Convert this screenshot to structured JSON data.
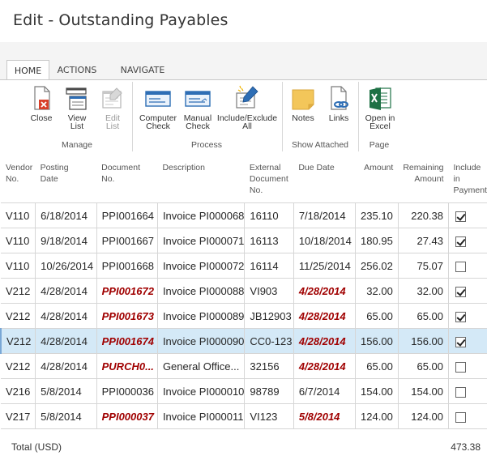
{
  "page": {
    "title": "Edit - Outstanding Payables"
  },
  "tabs": [
    {
      "label": "HOME"
    },
    {
      "label": "ACTIONS"
    },
    {
      "label": "NAVIGATE"
    }
  ],
  "ribbon": {
    "buttons": [
      {
        "label": "Close",
        "icon": "close-icon"
      },
      {
        "label": "View\nList",
        "icon": "view-list-icon"
      },
      {
        "label": "Edit\nList",
        "icon": "edit-list-icon"
      },
      {
        "label": "Computer\nCheck",
        "icon": "computer-check-icon"
      },
      {
        "label": "Manual\nCheck",
        "icon": "manual-check-icon"
      },
      {
        "label": "Include/Exclude\nAll",
        "icon": "include-exclude-icon"
      },
      {
        "label": "Notes",
        "icon": "notes-icon"
      },
      {
        "label": "Links",
        "icon": "links-icon"
      },
      {
        "label": "Open in\nExcel",
        "icon": "excel-icon"
      }
    ],
    "groups": [
      {
        "label": "Manage"
      },
      {
        "label": "Process"
      },
      {
        "label": "Show Attached"
      },
      {
        "label": "Page"
      }
    ]
  },
  "table": {
    "headers": [
      "Vendor\nNo.",
      "Posting\nDate",
      "Document\nNo.",
      "Description",
      "External\nDocument\nNo.",
      "Due Date",
      "Amount",
      "Remaining\nAmount",
      "Include\nin\nPayment"
    ],
    "rows": [
      {
        "vendor": "V110",
        "posting": "6/18/2014",
        "doc": "PPI001664",
        "desc": "Invoice PI000068",
        "ext": "16110",
        "due": "7/18/2014",
        "amount": "235.10",
        "remaining": "220.38",
        "include": true,
        "overdue": false,
        "selected": false
      },
      {
        "vendor": "V110",
        "posting": "9/18/2014",
        "doc": "PPI001667",
        "desc": "Invoice PI000071",
        "ext": "16113",
        "due": "10/18/2014",
        "amount": "180.95",
        "remaining": "27.43",
        "include": true,
        "overdue": false,
        "selected": false
      },
      {
        "vendor": "V110",
        "posting": "10/26/2014",
        "doc": "PPI001668",
        "desc": "Invoice PI000072",
        "ext": "16114",
        "due": "11/25/2014",
        "amount": "256.02",
        "remaining": "75.07",
        "include": false,
        "overdue": false,
        "selected": false
      },
      {
        "vendor": "V212",
        "posting": "4/28/2014",
        "doc": "PPI001672",
        "desc": "Invoice PI000088",
        "ext": "VI903",
        "due": "4/28/2014",
        "amount": "32.00",
        "remaining": "32.00",
        "include": true,
        "overdue": true,
        "selected": false
      },
      {
        "vendor": "V212",
        "posting": "4/28/2014",
        "doc": "PPI001673",
        "desc": "Invoice PI000089",
        "ext": "JB12903",
        "due": "4/28/2014",
        "amount": "65.00",
        "remaining": "65.00",
        "include": true,
        "overdue": true,
        "selected": false
      },
      {
        "vendor": "V212",
        "posting": "4/28/2014",
        "doc": "PPI001674",
        "desc": "Invoice PI000090",
        "ext": "CC0-123",
        "due": "4/28/2014",
        "amount": "156.00",
        "remaining": "156.00",
        "include": true,
        "overdue": true,
        "selected": true
      },
      {
        "vendor": "V212",
        "posting": "4/28/2014",
        "doc": "PURCH0...",
        "desc": "General Office...",
        "ext": "32156",
        "due": "4/28/2014",
        "amount": "65.00",
        "remaining": "65.00",
        "include": false,
        "overdue": true,
        "selected": false
      },
      {
        "vendor": "V216",
        "posting": "5/8/2014",
        "doc": "PPI000036",
        "desc": "Invoice PI000010",
        "ext": "98789",
        "due": "6/7/2014",
        "amount": "154.00",
        "remaining": "154.00",
        "include": false,
        "overdue": false,
        "selected": false
      },
      {
        "vendor": "V217",
        "posting": "5/8/2014",
        "doc": "PPI000037",
        "desc": "Invoice PI000011",
        "ext": "VI123",
        "due": "5/8/2014",
        "amount": "124.00",
        "remaining": "124.00",
        "include": false,
        "overdue": true,
        "selected": false
      }
    ]
  },
  "total": {
    "label": "Total (USD)",
    "value": "473.38"
  },
  "colors": {
    "overdue": "#a00000",
    "selected_row": "#d4e9f7",
    "excel_green": "#1e7145",
    "close_red": "#d8402a",
    "blue_icon": "#2e6eb5",
    "notes_yellow": "#f3c65a"
  }
}
